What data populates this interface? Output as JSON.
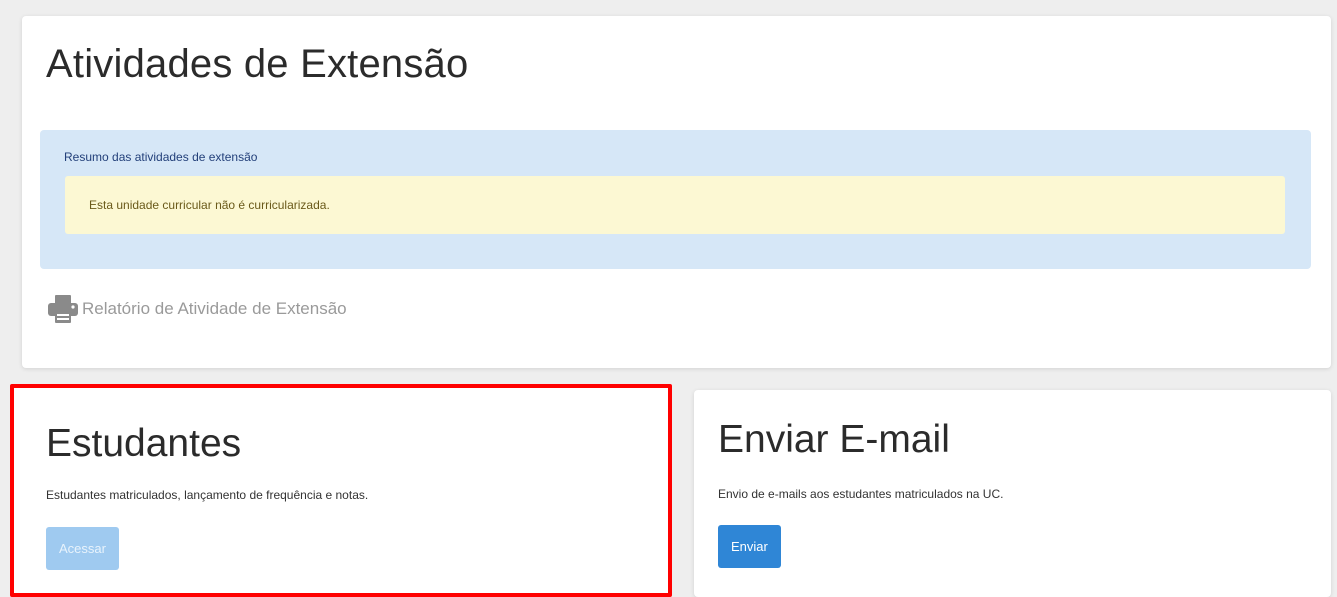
{
  "extension": {
    "title": "Atividades de Extensão",
    "summary_title": "Resumo das atividades de extensão",
    "warning_text": "Esta unidade curricular não é curricularizada.",
    "report_link_label": "Relatório de Atividade de Extensão",
    "report_icon": "printer-icon"
  },
  "students_card": {
    "title": "Estudantes",
    "description": "Estudantes matriculados, lançamento de frequência e notas.",
    "button_label": "Acessar"
  },
  "email_card": {
    "title": "Enviar E-mail",
    "description": "Envio de e-mails aos estudantes matriculados na UC.",
    "button_label": "Enviar"
  },
  "colors": {
    "info_background": "#d6e7f7",
    "warning_background": "#fcf8d3",
    "primary_button": "#2f86d6",
    "disabled_button": "#9fcaf0",
    "highlight_border": "#ff0000"
  }
}
